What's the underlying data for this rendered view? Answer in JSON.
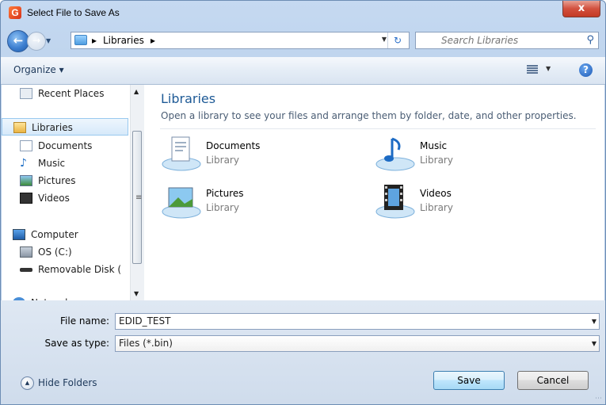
{
  "window": {
    "title": "Select File to Save As",
    "app_icon_glyph": "G",
    "close_glyph": "x"
  },
  "address": {
    "crumbs": [
      "Libraries"
    ],
    "separator": "▸",
    "search_placeholder": "Search Libraries"
  },
  "toolbar": {
    "organize_label": "Organize ▾"
  },
  "nav": {
    "items": [
      {
        "label": "Recent Places",
        "icon": "recent-places-icon"
      },
      {
        "label": "Libraries",
        "icon": "libraries-icon",
        "selected": true
      },
      {
        "label": "Documents",
        "icon": "documents-icon"
      },
      {
        "label": "Music",
        "icon": "music-icon"
      },
      {
        "label": "Pictures",
        "icon": "pictures-icon"
      },
      {
        "label": "Videos",
        "icon": "videos-icon"
      },
      {
        "label": "Computer",
        "icon": "computer-icon"
      },
      {
        "label": "OS (C:)",
        "icon": "drive-icon"
      },
      {
        "label": "Removable Disk (",
        "icon": "removable-disk-icon"
      },
      {
        "label": "Network",
        "icon": "network-icon"
      }
    ]
  },
  "libraries": {
    "title": "Libraries",
    "description": "Open a library to see your files and arrange them by folder, date, and other properties.",
    "items": [
      {
        "name": "Documents",
        "type": "Library",
        "icon": "documents-library-icon"
      },
      {
        "name": "Music",
        "type": "Library",
        "icon": "music-library-icon"
      },
      {
        "name": "Pictures",
        "type": "Library",
        "icon": "pictures-library-icon"
      },
      {
        "name": "Videos",
        "type": "Library",
        "icon": "videos-library-icon"
      }
    ]
  },
  "form": {
    "file_name_label": "File name:",
    "file_name_value": "EDID_TEST",
    "save_type_label": "Save as type:",
    "save_type_value": "Files (*.bin)"
  },
  "footer": {
    "hide_folders_label": "Hide Folders",
    "save_label": "Save",
    "cancel_label": "Cancel"
  },
  "colors": {
    "accent": "#1e5a96",
    "title_bar": "#b6cde8",
    "close_button": "#c43a25"
  }
}
